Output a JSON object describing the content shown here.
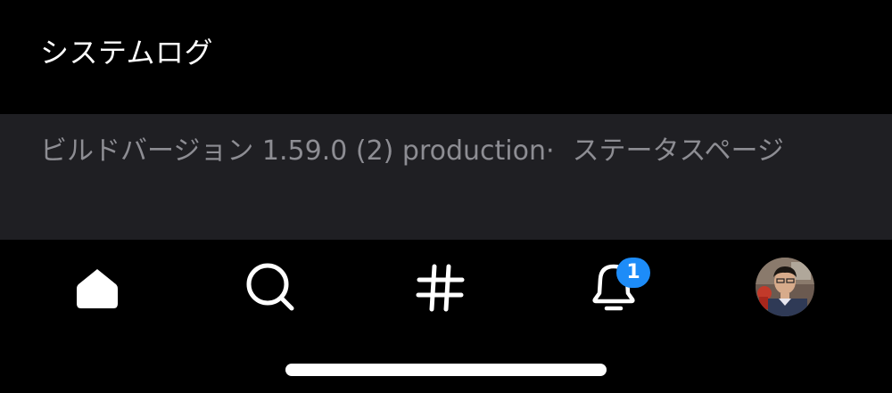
{
  "menu": {
    "system_log_label": "システムログ"
  },
  "footer": {
    "build_version_text": "ビルドバージョン 1.59.0 (2) production·",
    "status_page_link": "ステータスページ"
  },
  "tabbar": {
    "items": [
      {
        "name": "home",
        "icon": "home-icon",
        "active": true
      },
      {
        "name": "search",
        "icon": "search-icon",
        "active": false
      },
      {
        "name": "hashtag",
        "icon": "hashtag-icon",
        "active": false
      },
      {
        "name": "notifications",
        "icon": "bell-icon",
        "active": false,
        "badge": "1"
      },
      {
        "name": "profile",
        "icon": "avatar",
        "active": false
      }
    ]
  },
  "colors": {
    "background": "#000000",
    "footer_background": "#1f1f23",
    "muted_text": "#8d8d93",
    "badge_blue": "#1d8cf8"
  }
}
